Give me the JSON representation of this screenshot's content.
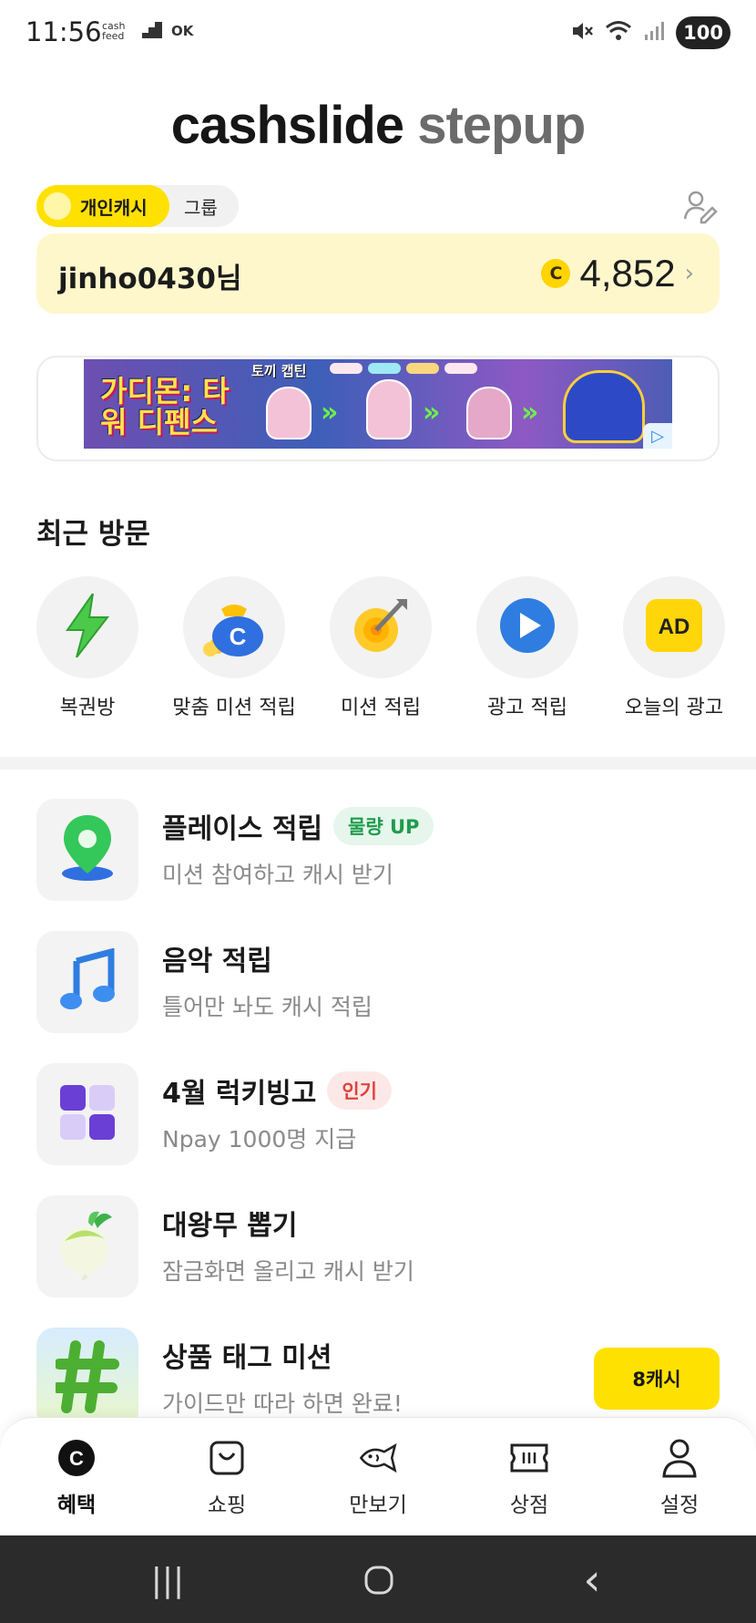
{
  "status_bar": {
    "time": "11:56",
    "left_icons": [
      "cash feed",
      "stairs",
      "OK"
    ],
    "battery": "100",
    "battery_icon": "battery-pill-icon",
    "colors": {
      "text": "#222222"
    }
  },
  "header": {
    "brand": "cashslide",
    "sub": "stepup"
  },
  "account_toggle": {
    "active_label": "개인캐시",
    "inactive_label": "그룹"
  },
  "account": {
    "username": "jinho0430님",
    "coin_symbol": "C",
    "balance": "4,852"
  },
  "ad": {
    "title": "가디몬: 타워 디펜스",
    "subtitle": "토끼 캡틴"
  },
  "recent": {
    "title": "최근 방문",
    "items": [
      {
        "label": "복권방",
        "icon": "lightning-icon"
      },
      {
        "label": "맞춤 미션 적립",
        "icon": "money-bag-icon"
      },
      {
        "label": "미션 적립",
        "icon": "target-icon"
      },
      {
        "label": "광고 적립",
        "icon": "play-icon"
      },
      {
        "label": "오늘의 광고",
        "icon": "ad-icon"
      }
    ]
  },
  "menu": [
    {
      "title": "플레이스 적립",
      "badge": "물량 UP",
      "desc": "미션 참여하고 캐시 받기",
      "icon": "map-pin-icon"
    },
    {
      "title": "음악 적립",
      "badge": "",
      "desc": "틀어만 놔도 캐시 적립",
      "icon": "music-note-icon"
    },
    {
      "title": "4월 럭키빙고",
      "badge": "인기",
      "desc": "Npay 1000명 지급",
      "icon": "grid-icon"
    },
    {
      "title": "대왕무 뽑기",
      "badge": "",
      "desc": "잠금화면 올리고 캐시 받기",
      "icon": "radish-icon"
    },
    {
      "title": "상품 태그 미션",
      "badge": "",
      "desc": "가이드만 따라 하면 완료!",
      "icon": "hashtag-icon",
      "reward": "8캐시"
    }
  ],
  "bottom_nav": [
    {
      "label": "혜택",
      "icon": "coin-c-icon",
      "active": true
    },
    {
      "label": "쇼핑",
      "icon": "shopping-bag-icon"
    },
    {
      "label": "만보기",
      "icon": "fish-icon"
    },
    {
      "label": "상점",
      "icon": "ticket-icon"
    },
    {
      "label": "설정",
      "icon": "user-icon"
    }
  ],
  "system_nav": {
    "recents": "|||",
    "home": "○",
    "back": "‹"
  },
  "colors": {
    "accent": "#ffe100",
    "card_bg": "#fff7cc",
    "badge_green": "#1f9c4c",
    "badge_red": "#e0433b"
  }
}
